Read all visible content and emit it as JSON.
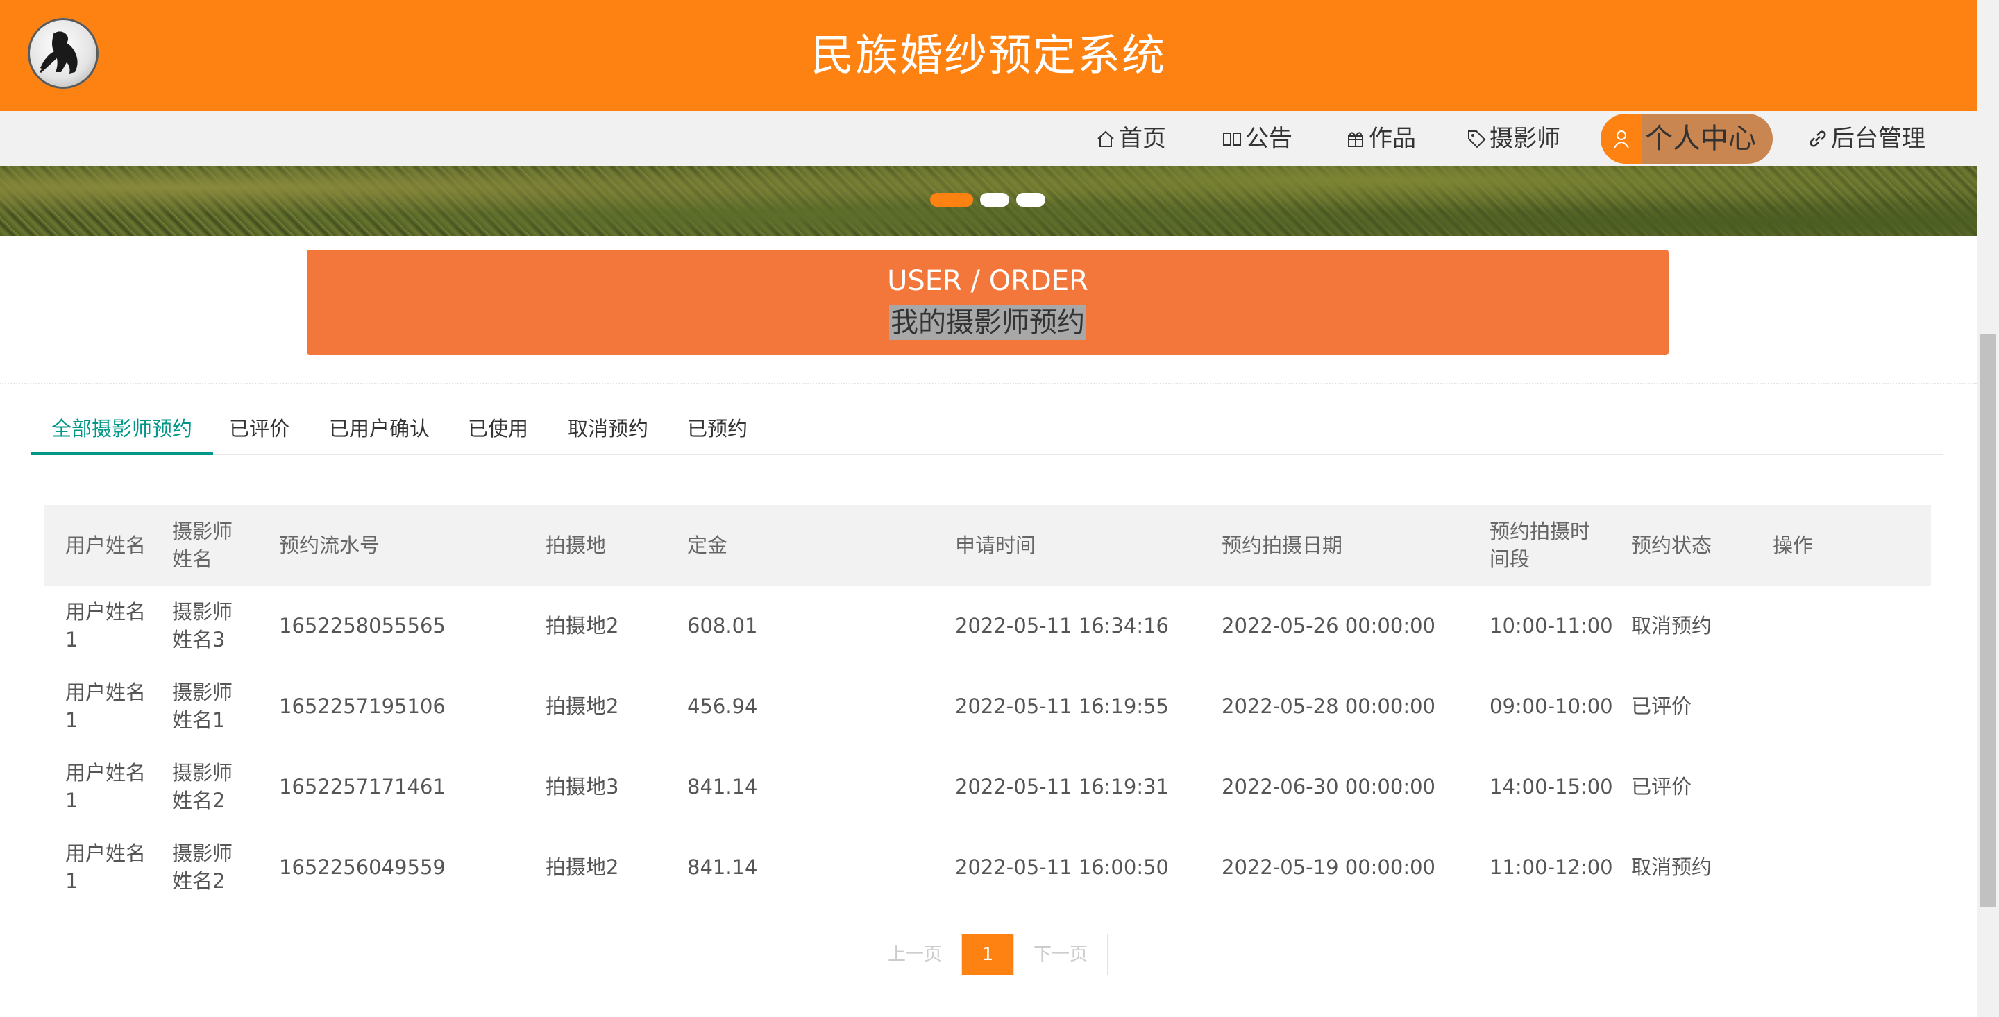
{
  "site": {
    "title": "民族婚纱预定系统",
    "brand_color": "#fd8212",
    "logo_icon": "silhouette-logo-icon"
  },
  "nav": {
    "items": [
      {
        "label": "首页",
        "icon": "home-icon"
      },
      {
        "label": "公告",
        "icon": "book-icon"
      },
      {
        "label": "作品",
        "icon": "gift-icon"
      },
      {
        "label": "摄影师",
        "icon": "tag-icon"
      },
      {
        "label": "个人中心",
        "icon": "user-icon",
        "active": true
      },
      {
        "label": "后台管理",
        "icon": "link-icon"
      }
    ]
  },
  "carousel": {
    "slide_count": 3,
    "active_index": 0,
    "active_color": "#fd8212",
    "inactive_color": "#ffffff"
  },
  "page_header": {
    "en": "USER / ORDER",
    "cn": "我的摄影师预约",
    "color": "#f3763a"
  },
  "tabs": [
    {
      "label": "全部摄影师预约",
      "active": true
    },
    {
      "label": "已评价"
    },
    {
      "label": "已用户确认"
    },
    {
      "label": "已使用"
    },
    {
      "label": "取消预约"
    },
    {
      "label": "已预约"
    }
  ],
  "table": {
    "columns": [
      "用户姓名",
      "摄影师姓名",
      "预约流水号",
      "拍摄地",
      "定金",
      "申请时间",
      "预约拍摄日期",
      "预约拍摄时间段",
      "预约状态",
      "操作"
    ],
    "rows": [
      [
        "用户姓名1",
        "摄影师姓名3",
        "1652258055565",
        "拍摄地2",
        "608.01",
        "2022-05-11 16:34:16",
        "2022-05-26 00:00:00",
        "10:00-11:00",
        "取消预约",
        ""
      ],
      [
        "用户姓名1",
        "摄影师姓名1",
        "1652257195106",
        "拍摄地2",
        "456.94",
        "2022-05-11 16:19:55",
        "2022-05-28 00:00:00",
        "09:00-10:00",
        "已评价",
        ""
      ],
      [
        "用户姓名1",
        "摄影师姓名2",
        "1652257171461",
        "拍摄地3",
        "841.14",
        "2022-05-11 16:19:31",
        "2022-06-30 00:00:00",
        "14:00-15:00",
        "已评价",
        ""
      ],
      [
        "用户姓名1",
        "摄影师姓名2",
        "1652256049559",
        "拍摄地2",
        "841.14",
        "2022-05-11 16:00:50",
        "2022-05-19 00:00:00",
        "11:00-12:00",
        "取消预约",
        ""
      ]
    ]
  },
  "pagination": {
    "prev": "上一页",
    "current": "1",
    "next": "下一页"
  }
}
